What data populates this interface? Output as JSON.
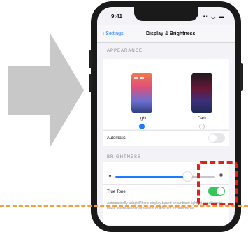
{
  "arrow": {
    "color": "#c8c8c8"
  },
  "status_bar": {
    "time": "9:41",
    "icons": "▪▪ ◡ ▬"
  },
  "nav": {
    "back_label": "‹ Settings",
    "title": "Display & Brightness"
  },
  "appearance": {
    "header": "APPEARANCE",
    "modes": [
      {
        "label": "Light",
        "selected": true,
        "name": "light"
      },
      {
        "label": "Dark",
        "selected": false,
        "name": "dark"
      }
    ],
    "automatic_label": "Automatic",
    "automatic_on": false
  },
  "brightness": {
    "header": "BRIGHTNESS",
    "level": 0.72,
    "true_tone_label": "True Tone",
    "true_tone_on": true,
    "description": "Automatically adapt iPhone display based on ambient lighting conditions to make colors appear consistent in different environments."
  },
  "colors": {
    "accent": "#1a7cff",
    "toggle_on": "#34c759",
    "highlight": "#e32018",
    "guide": "#f2a03a"
  }
}
